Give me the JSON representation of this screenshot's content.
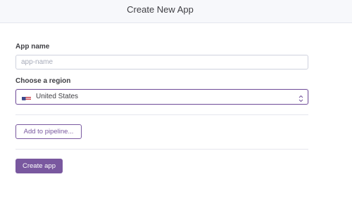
{
  "header": {
    "title": "Create New App"
  },
  "form": {
    "app_name": {
      "label": "App name",
      "value": "",
      "placeholder": "app-name"
    },
    "region": {
      "label": "Choose a region",
      "selected": "United States",
      "flag_icon": "us-flag-icon"
    },
    "pipeline_button_label": "Add to pipeline...",
    "submit_button_label": "Create app"
  },
  "colors": {
    "accent": "#79589f",
    "header_background": "#f7f8fb",
    "divider": "#e6e7ee"
  }
}
